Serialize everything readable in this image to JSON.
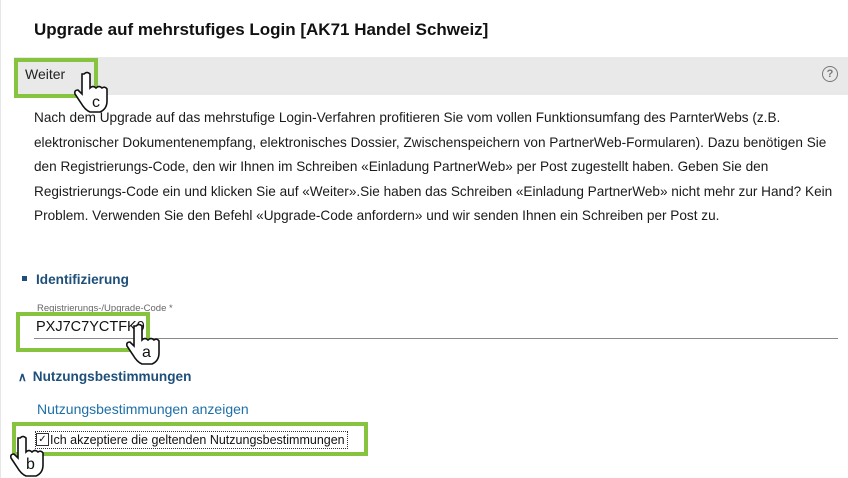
{
  "page": {
    "title": "Upgrade auf mehrstufiges Login [AK71 Handel Schweiz]"
  },
  "toolbar": {
    "weiter_label": "Weiter",
    "help_icon": "?"
  },
  "description": "Nach dem Upgrade auf das mehrstufige Login-Verfahren profitieren Sie vom vollen Funktionsumfang des ParnterWebs (z.B. elektronischer Dokumentenempfang, elektronisches Dossier, Zwischenspeichern von PartnerWeb-Formularen). Dazu benötigen Sie den Registrierungs-Code, den wir Ihnen im Schreiben «Einladung PartnerWeb» per Post zugestellt haben. Geben Sie den Registrierungs-Code ein und klicken Sie auf «Weiter».Sie haben das Schreiben «Einladung PartnerWeb» nicht mehr zur Hand? Kein Problem. Verwenden Sie den Befehl «Upgrade-Code anfordern» und wir senden Ihnen ein Schreiben per Post zu.",
  "identifizierung": {
    "heading": "Identifizierung",
    "field_label": "Registrierungs-/Upgrade-Code *",
    "field_value": "PXJ7C7YCTFK9"
  },
  "nutzung": {
    "heading": "Nutzungsbestimmungen",
    "link_label": "Nutzungsbestimmungen anzeigen",
    "checkbox_label": "Ich akzeptiere die geltenden Nutzungsbestimmungen",
    "checkbox_checked": true
  },
  "annotations": {
    "label_a": "a",
    "label_b": "b",
    "label_c": "c",
    "highlight_color": "#86c440"
  }
}
